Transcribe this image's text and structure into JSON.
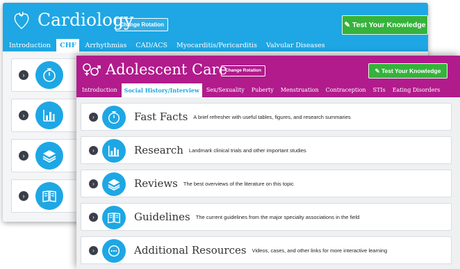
{
  "colors": {
    "cardiology_blue": "#1ea7e4",
    "adolescent_magenta": "#b11b8c",
    "green_button": "#35b33b"
  },
  "back_window": {
    "title": "Cardiology",
    "logo_icon": "heart-outline-icon",
    "change_rotation_label": "Change Rotation",
    "test_button_label": "Test Your Knowledge",
    "tabs": [
      "Introduction",
      "CHF",
      "Arrhythmias",
      "CAD/ACS",
      "Myocarditis/Pericarditis",
      "Valvular Diseases"
    ],
    "active_tab": "CHF",
    "card_icons": [
      "stopwatch-icon",
      "bar-chart-icon",
      "layers-icon",
      "open-book-icon"
    ]
  },
  "front_window": {
    "title": "Adolescent Care",
    "logo_icon": "gender-symbols-icon",
    "change_rotation_label": "Change Rotation",
    "test_button_label": "Test Your Knowledge",
    "tabs": [
      "Introduction",
      "Social History/Interview",
      "Sex/Sexuality",
      "Puberty",
      "Menstruation",
      "Contraception",
      "STIs",
      "Eating Disorders"
    ],
    "active_tab": "Social History/Interview",
    "sections": [
      {
        "title": "Fast Facts",
        "description": "A brief refresher with useful tables, figures, and research summaries",
        "icon": "stopwatch-icon"
      },
      {
        "title": "Research",
        "description": "Landmark clinical trials and other important studies",
        "icon": "bar-chart-icon"
      },
      {
        "title": "Reviews",
        "description": "The best overviews of the literature on this topic",
        "icon": "layers-icon"
      },
      {
        "title": "Guidelines",
        "description": "The current guidelines from the major specialty associations in the field",
        "icon": "open-book-icon"
      },
      {
        "title": "Additional Resources",
        "description": "Videos, cases, and other links for more interactive learning",
        "icon": "ellipsis-circle-icon"
      }
    ]
  }
}
